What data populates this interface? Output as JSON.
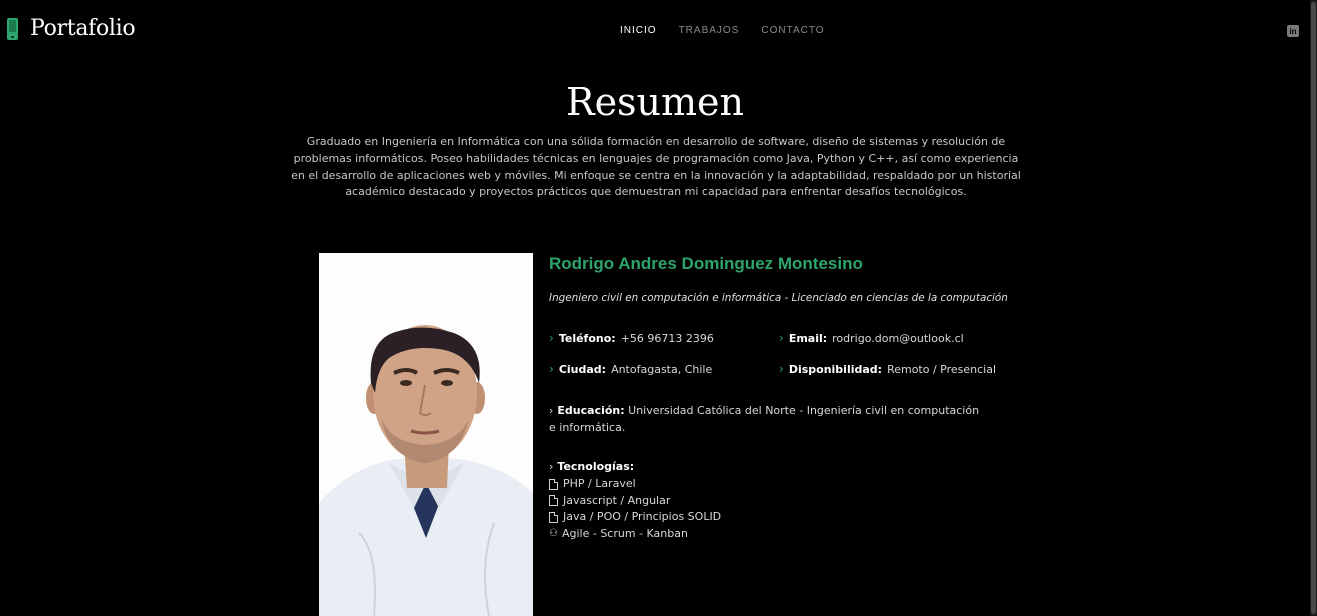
{
  "header": {
    "brand": "Portafolio",
    "nav": [
      {
        "label": "INICIO",
        "active": true
      },
      {
        "label": "TRABAJOS",
        "active": false
      },
      {
        "label": "CONTACTO",
        "active": false
      }
    ],
    "social_icon": "linkedin-icon",
    "social_glyph": "in"
  },
  "resumen": {
    "title": "Resumen",
    "text": "Graduado en Ingeniería en Informática con una sólida formación en desarrollo de software, diseño de sistemas y resolución de problemas informáticos. Poseo habilidades técnicas en lenguajes de programación como Java, Python y C++, así como experiencia en el desarrollo de aplicaciones web y móviles. Mi enfoque se centra en la innovación y la adaptabilidad, respaldado por un historial académico destacado y proyectos prácticos que demuestran mi capacidad para enfrentar desafíos tecnológicos."
  },
  "profile": {
    "name": "Rodrigo Andres Dominguez Montesino",
    "subtitle": "Ingeniero civil en computación e informática - Licenciado en ciencias de la computación",
    "telefono_label": "Teléfono:",
    "telefono": "+56 96713 2396",
    "email_label": "Email:",
    "email": "rodrigo.dom@outlook.cl",
    "ciudad_label": "Ciudad:",
    "ciudad": "Antofagasta, Chile",
    "disponibilidad_label": "Disponibilidad:",
    "disponibilidad": "Remoto / Presencial",
    "educacion_label": "Educación:",
    "educacion": "Universidad Católica del Norte - Ingeniería civil en computación e informática.",
    "tecnologias_label": "Tecnologías:",
    "tecnologias": [
      {
        "label": "PHP / Laravel",
        "icon": "file-code-icon"
      },
      {
        "label": "Javascript / Angular",
        "icon": "file-code-icon"
      },
      {
        "label": "Java / POO / Principios SOLID",
        "icon": "file-code-icon"
      },
      {
        "label": "Agile - Scrum - Kanban",
        "icon": "people-icon"
      }
    ]
  },
  "colors": {
    "accent": "#2fa36c",
    "background": "#000000"
  }
}
